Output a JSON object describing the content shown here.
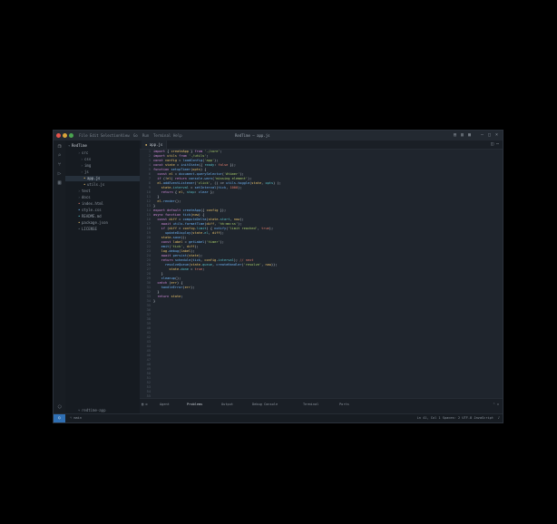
{
  "titlebar": {
    "menu": [
      "File",
      "Edit",
      "Selection",
      "View",
      "Go",
      "Run",
      "Terminal",
      "Help"
    ],
    "title": "RedTime — app.js"
  },
  "sidebar": {
    "header": "RedTime",
    "items": [
      {
        "label": "src",
        "indent": 1
      },
      {
        "label": "css",
        "indent": 2
      },
      {
        "label": "img",
        "indent": 2
      },
      {
        "label": "js",
        "indent": 2
      },
      {
        "label": "app.js",
        "indent": 3,
        "selected": true
      },
      {
        "label": "utils.js",
        "indent": 3
      },
      {
        "label": "test",
        "indent": 1
      },
      {
        "label": "docs",
        "indent": 1
      },
      {
        "label": "index.html",
        "indent": 1
      },
      {
        "label": "style.css",
        "indent": 1
      },
      {
        "label": "README.md",
        "indent": 1
      },
      {
        "label": "package.json",
        "indent": 1
      },
      {
        "label": "LICENSE",
        "indent": 1
      }
    ],
    "footer": "redtime-app"
  },
  "editor": {
    "tab": "app.js"
  },
  "bottom_panel": {
    "items": [
      "Agent",
      "Problems",
      "Output",
      "Debug Console",
      "Terminal",
      "Ports"
    ]
  },
  "statusbar": {
    "left": "main",
    "right": "Ln 41, Col 1   Spaces: 2   UTF-8   JavaScript"
  }
}
